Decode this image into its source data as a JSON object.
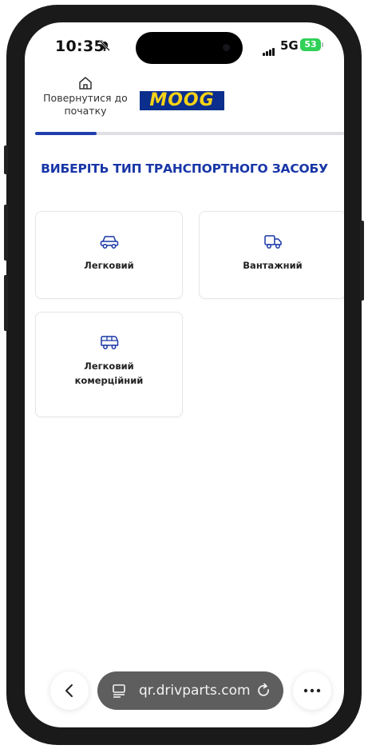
{
  "status_bar": {
    "time": "10:35",
    "network": "5G",
    "battery": "53"
  },
  "header": {
    "home_label": "Повернутися до початку",
    "logo_text": "MOOG"
  },
  "progress": {
    "fraction": 0.2
  },
  "page": {
    "title": "ВИБЕРІТЬ ТИП ТРАНСПОРТНОГО ЗАСОБУ"
  },
  "vehicle_types": [
    {
      "label": "Легковий",
      "icon": "car-icon"
    },
    {
      "label": "Вантажний",
      "icon": "truck-icon"
    },
    {
      "label": "Легковий комерційний",
      "icon": "van-icon"
    }
  ],
  "browser": {
    "url": "qr.drivparts.com"
  },
  "colors": {
    "accent": "#1836a7",
    "logo_bg": "#0c2e8c",
    "logo_text": "#f7d417",
    "battery": "#2fd158"
  }
}
